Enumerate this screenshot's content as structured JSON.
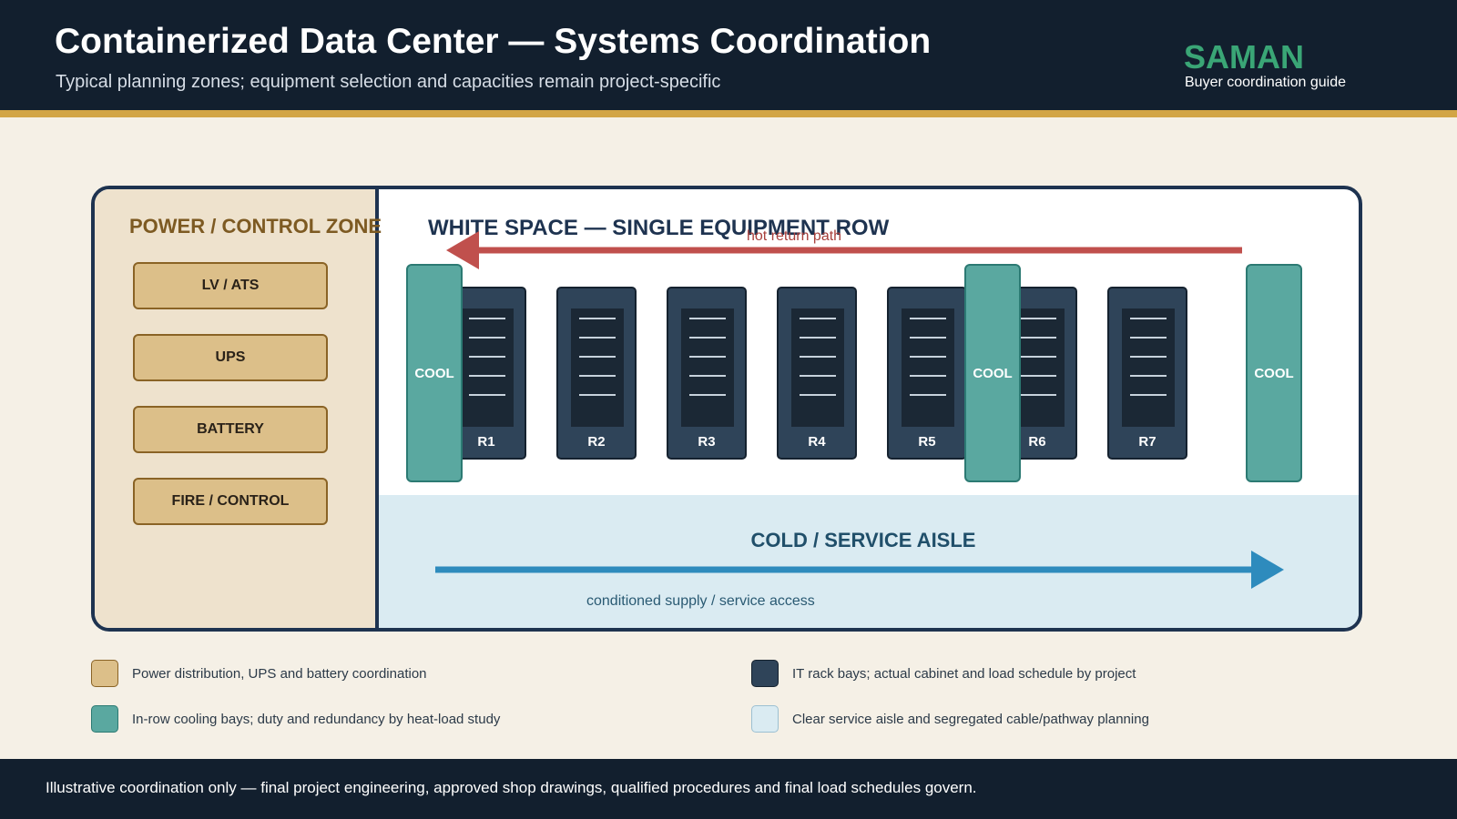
{
  "header": {
    "title": "Containerized Data Center — Systems Coordination",
    "subtitle": "Typical planning zones; equipment selection and capacities remain project-specific",
    "brand": "SAMAN",
    "brand_tagline": "Buyer coordination guide"
  },
  "power_zone": {
    "heading": "POWER / CONTROL ZONE",
    "equipment": [
      "LV / ATS",
      "UPS",
      "BATTERY",
      "FIRE / CONTROL"
    ]
  },
  "white_space": {
    "heading": "WHITE SPACE — SINGLE EQUIPMENT ROW",
    "hot_path_label": "hot return path",
    "racks": [
      "R1",
      "R2",
      "R3",
      "R4",
      "R5",
      "R6",
      "R7"
    ],
    "cooling_label": "COOL"
  },
  "cold_aisle": {
    "heading": "COLD / SERVICE AISLE",
    "caption": "conditioned supply / service access"
  },
  "legend": [
    {
      "text": "Power distribution, UPS and battery coordination",
      "color": "#dcbf89"
    },
    {
      "text": "IT rack bays; actual cabinet and load schedule by project",
      "color": "#2f4459"
    },
    {
      "text": "In-row cooling bays; duty and redundancy by heat-load study",
      "color": "#5aa8a0"
    },
    {
      "text": "Clear service aisle and segregated cable/pathway planning",
      "color": "#daebf2"
    }
  ],
  "colors": {
    "hot_path": "#c0504d",
    "cold_path": "#2e8bbd",
    "accent_rule": "#d2a546",
    "navy": "#121f2e"
  },
  "footer": {
    "text": "Illustrative coordination only — final project engineering, approved shop drawings, qualified procedures and final load schedules govern."
  }
}
